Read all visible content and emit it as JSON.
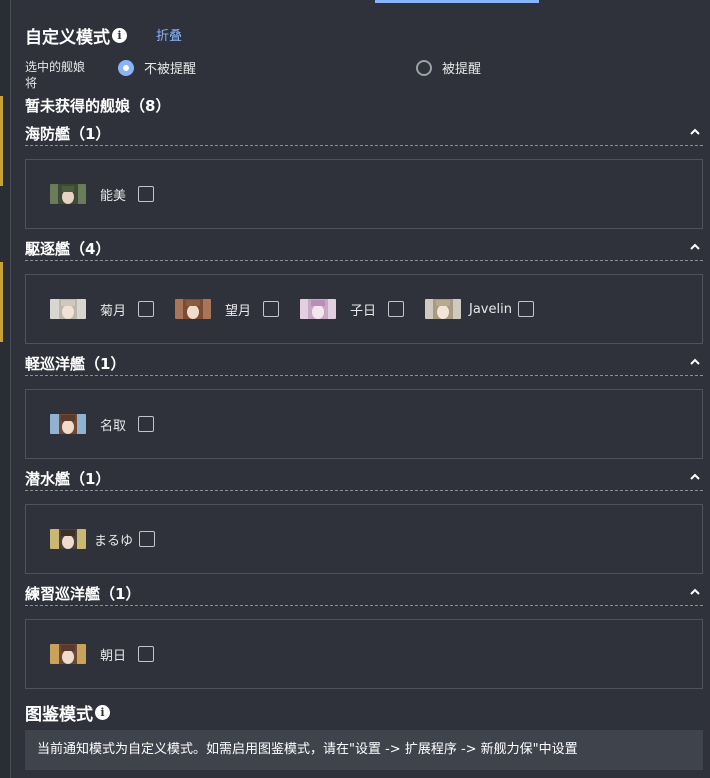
{
  "custom_mode": {
    "title": "自定义模式",
    "collapse_label": "折叠",
    "selected_label_line1": "选中的舰娘",
    "selected_label_line2": "将",
    "options": [
      {
        "label": "不被提醒",
        "checked": true
      },
      {
        "label": "被提醒",
        "checked": false
      }
    ]
  },
  "unobtained": {
    "heading": "暂未获得的舰娘（8）",
    "groups": [
      {
        "title": "海防艦（1）",
        "ships": [
          {
            "name": "能美",
            "checked": false
          }
        ]
      },
      {
        "title": "駆逐艦（4）",
        "ships": [
          {
            "name": "菊月",
            "checked": false
          },
          {
            "name": "望月",
            "checked": false
          },
          {
            "name": "子日",
            "checked": false
          },
          {
            "name": "Javelin",
            "checked": false
          }
        ]
      },
      {
        "title": "軽巡洋艦（1）",
        "ships": [
          {
            "name": "名取",
            "checked": false
          }
        ]
      },
      {
        "title": "潜水艦（1）",
        "ships": [
          {
            "name": "まるゆ",
            "checked": false
          }
        ]
      },
      {
        "title": "練習巡洋艦（1）",
        "ships": [
          {
            "name": "朝日",
            "checked": false
          }
        ]
      }
    ]
  },
  "illustrated_mode": {
    "title": "图鉴模式",
    "notice": "当前通知模式为自定义模式。如需启用图鉴模式，请在\"设置 -> 扩展程序 -> 新舰力保\"中设置"
  },
  "colors": {
    "panel_bg": "#2f323a",
    "accent": "#8ab4f8",
    "notice_bg": "#3f434c"
  }
}
